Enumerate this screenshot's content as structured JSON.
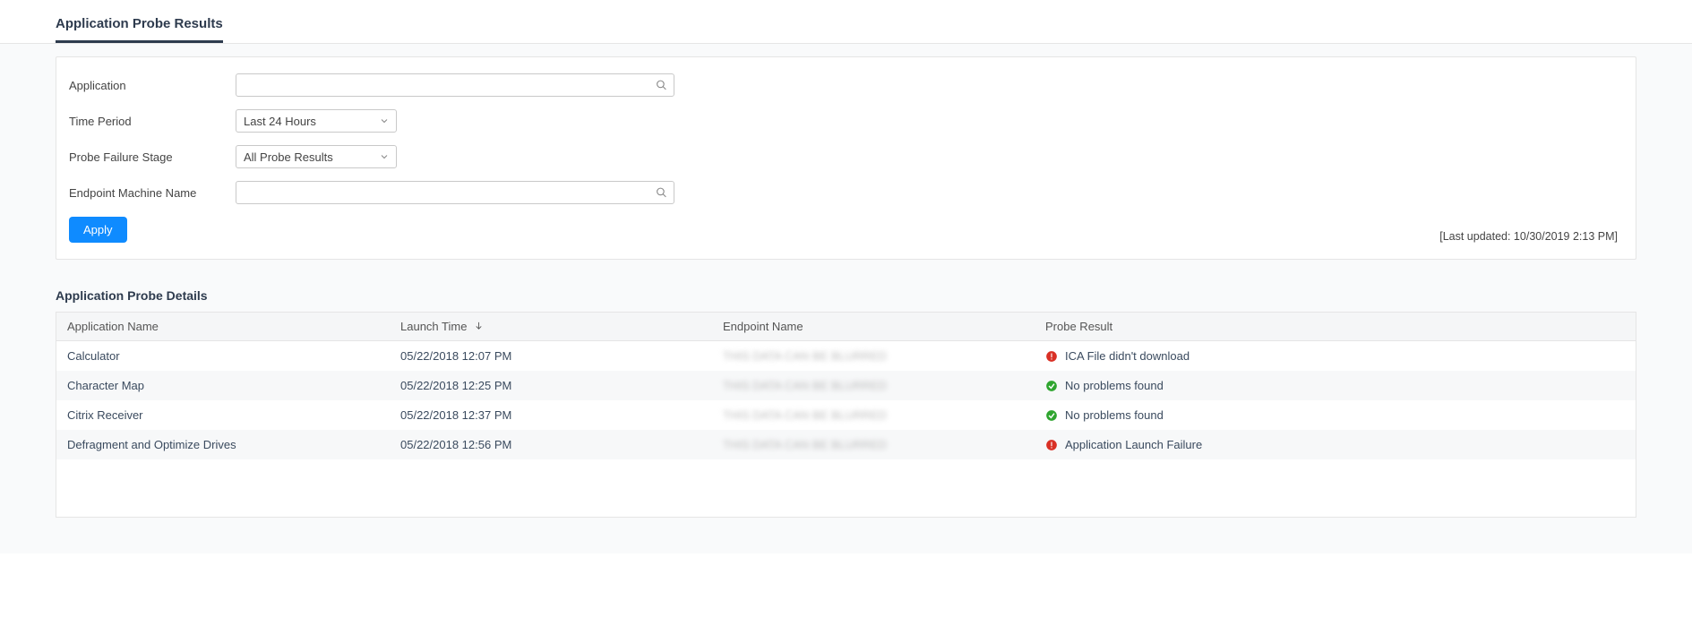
{
  "tabs": {
    "active": "Application Probe Results"
  },
  "filters": {
    "labels": {
      "application": "Application",
      "time_period": "Time Period",
      "probe_failure_stage": "Probe Failure Stage",
      "endpoint_machine_name": "Endpoint Machine Name"
    },
    "values": {
      "application": "",
      "time_period": "Last 24 Hours",
      "probe_failure_stage": "All Probe Results",
      "endpoint_machine_name": ""
    },
    "apply_label": "Apply",
    "last_updated": "[Last updated: 10/30/2019 2:13 PM]"
  },
  "details": {
    "title": "Application Probe Details",
    "columns": {
      "application_name": "Application Name",
      "launch_time": "Launch Time",
      "endpoint_name": "Endpoint Name",
      "probe_result": "Probe Result"
    },
    "rows": [
      {
        "application_name": "Calculator",
        "launch_time": "05/22/2018 12:07 PM",
        "endpoint_name": "THIS DATA CAN BE BLURRED",
        "probe_result": {
          "status": "error",
          "text": "ICA File didn't download"
        }
      },
      {
        "application_name": "Character Map",
        "launch_time": "05/22/2018 12:25 PM",
        "endpoint_name": "THIS DATA CAN BE BLURRED",
        "probe_result": {
          "status": "ok",
          "text": "No problems found"
        }
      },
      {
        "application_name": "Citrix Receiver",
        "launch_time": "05/22/2018 12:37 PM",
        "endpoint_name": "THIS DATA CAN BE BLURRED",
        "probe_result": {
          "status": "ok",
          "text": "No problems found"
        }
      },
      {
        "application_name": "Defragment and Optimize Drives",
        "launch_time": "05/22/2018 12:56 PM",
        "endpoint_name": "THIS DATA CAN BE BLURRED",
        "probe_result": {
          "status": "error",
          "text": "Application Launch Failure"
        }
      }
    ]
  },
  "icons": {
    "search": "search-icon",
    "chevron_down": "chevron-down-icon",
    "sort_desc": "sort-arrow-down-icon",
    "status_ok": "check-circle-icon",
    "status_error": "alert-circle-icon"
  },
  "colors": {
    "primary": "#0f8bff",
    "ok": "#2fa52f",
    "error": "#d93025",
    "heading": "#2e3b4e"
  }
}
